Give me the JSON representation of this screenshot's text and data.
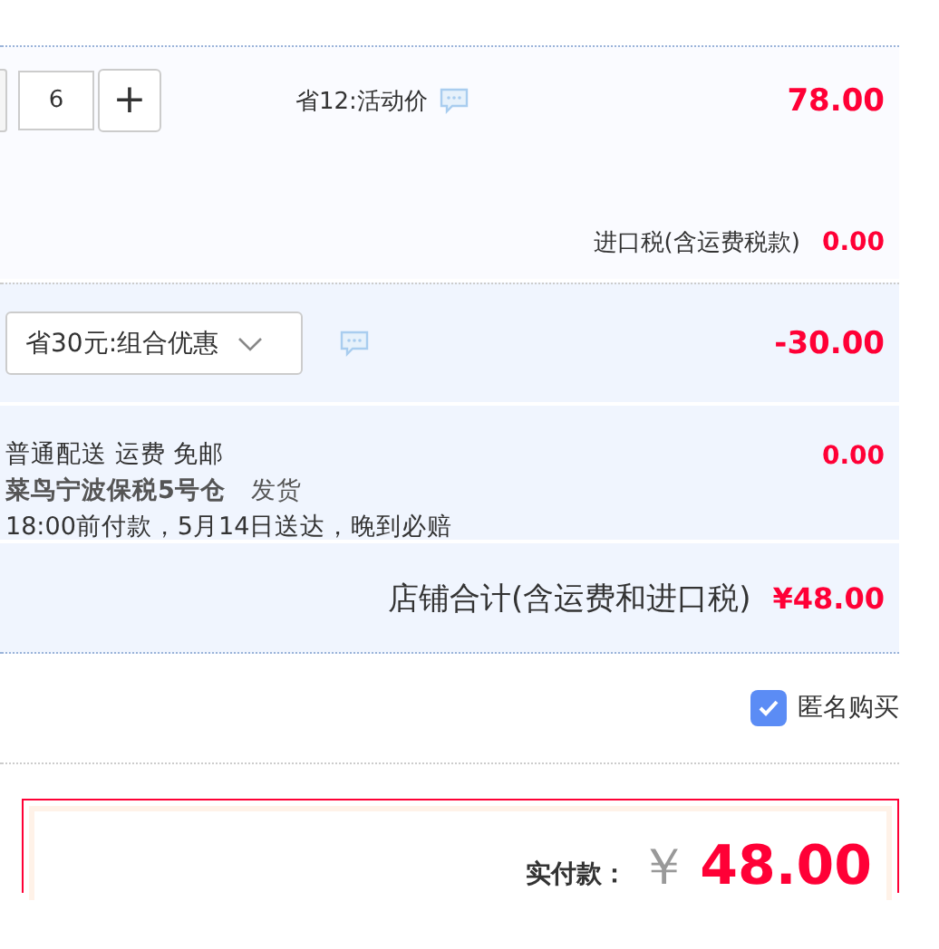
{
  "quantity": {
    "value": "6",
    "increment": "+"
  },
  "promotion": {
    "label": "省12:活动价",
    "price": "78.00"
  },
  "import_tax": {
    "label": "进口税(含运费税款)",
    "amount": "0.00"
  },
  "discount": {
    "selected_option": "省30元:组合优惠",
    "amount": "-30.00"
  },
  "shipping": {
    "method": "普通配送 运费 免邮",
    "warehouse": "菜鸟宁波保税5号仓",
    "dispatch": "发货",
    "delivery_note": "18:00前付款，5月14日送达，晚到必赔",
    "amount": "0.00"
  },
  "shop_total": {
    "label": "店铺合计(含运费和进口税)",
    "amount": "¥48.00"
  },
  "anonymous": {
    "label": "匿名购买",
    "checked": true
  },
  "payment": {
    "label": "实付款：",
    "currency": "￥",
    "amount": "48.00"
  }
}
